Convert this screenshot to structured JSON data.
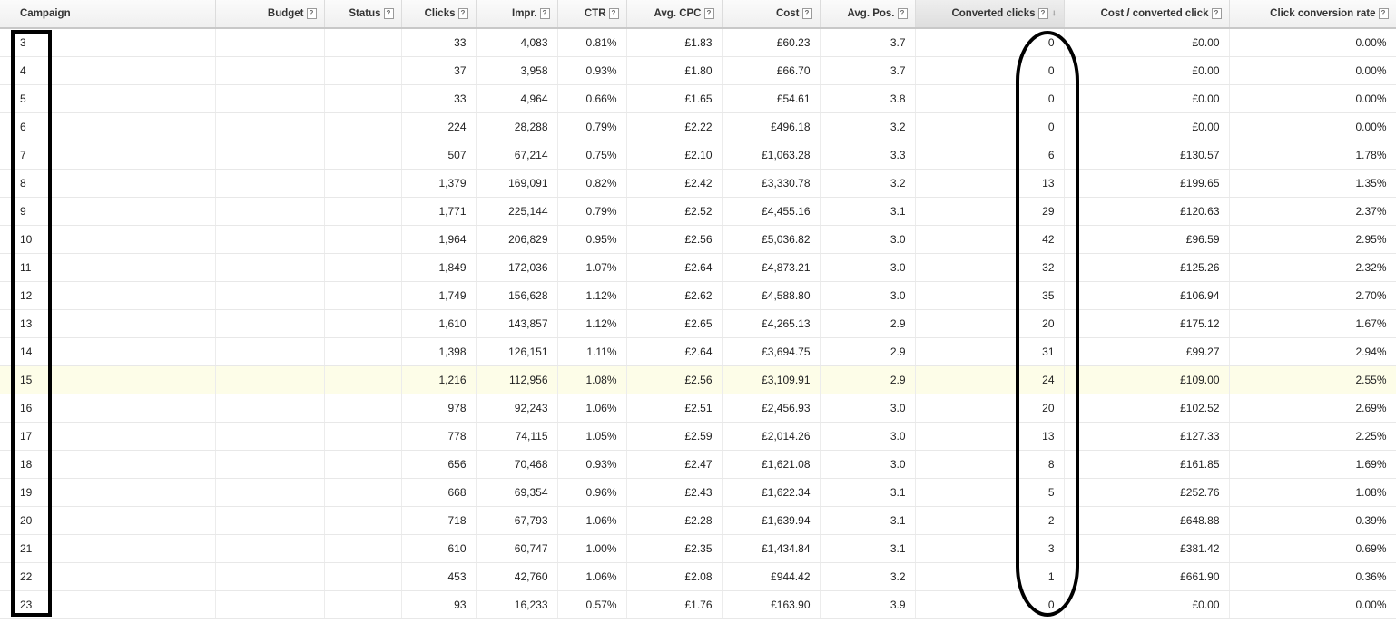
{
  "table": {
    "columns": [
      {
        "key": "campaign",
        "label": "Campaign",
        "help": false,
        "sorted": false
      },
      {
        "key": "budget",
        "label": "Budget",
        "help": true,
        "sorted": false
      },
      {
        "key": "status",
        "label": "Status",
        "help": true,
        "sorted": false
      },
      {
        "key": "clicks",
        "label": "Clicks",
        "help": true,
        "sorted": false
      },
      {
        "key": "impr",
        "label": "Impr.",
        "help": true,
        "sorted": false
      },
      {
        "key": "ctr",
        "label": "CTR",
        "help": true,
        "sorted": false
      },
      {
        "key": "avg_cpc",
        "label": "Avg. CPC",
        "help": true,
        "sorted": false
      },
      {
        "key": "cost",
        "label": "Cost",
        "help": true,
        "sorted": false
      },
      {
        "key": "avg_pos",
        "label": "Avg. Pos.",
        "help": true,
        "sorted": false
      },
      {
        "key": "converted_clicks",
        "label": "Converted clicks",
        "help": true,
        "sorted": true
      },
      {
        "key": "cost_per_converted",
        "label": "Cost / converted click",
        "help": true,
        "sorted": false
      },
      {
        "key": "click_conv_rate",
        "label": "Click conversion rate",
        "help": true,
        "sorted": false
      }
    ],
    "help_glyph": "?",
    "sort_glyph": "↓",
    "highlight_color": "#fdfde8",
    "annotation_color": "#000000",
    "rows": [
      {
        "campaign": "3",
        "budget": "",
        "status": "",
        "clicks": "33",
        "impr": "4,083",
        "ctr": "0.81%",
        "avg_cpc": "£1.83",
        "cost": "£60.23",
        "avg_pos": "3.7",
        "converted_clicks": "0",
        "cost_per_converted": "£0.00",
        "click_conv_rate": "0.00%"
      },
      {
        "campaign": "4",
        "budget": "",
        "status": "",
        "clicks": "37",
        "impr": "3,958",
        "ctr": "0.93%",
        "avg_cpc": "£1.80",
        "cost": "£66.70",
        "avg_pos": "3.7",
        "converted_clicks": "0",
        "cost_per_converted": "£0.00",
        "click_conv_rate": "0.00%"
      },
      {
        "campaign": "5",
        "budget": "",
        "status": "",
        "clicks": "33",
        "impr": "4,964",
        "ctr": "0.66%",
        "avg_cpc": "£1.65",
        "cost": "£54.61",
        "avg_pos": "3.8",
        "converted_clicks": "0",
        "cost_per_converted": "£0.00",
        "click_conv_rate": "0.00%"
      },
      {
        "campaign": "6",
        "budget": "",
        "status": "",
        "clicks": "224",
        "impr": "28,288",
        "ctr": "0.79%",
        "avg_cpc": "£2.22",
        "cost": "£496.18",
        "avg_pos": "3.2",
        "converted_clicks": "0",
        "cost_per_converted": "£0.00",
        "click_conv_rate": "0.00%"
      },
      {
        "campaign": "7",
        "budget": "",
        "status": "",
        "clicks": "507",
        "impr": "67,214",
        "ctr": "0.75%",
        "avg_cpc": "£2.10",
        "cost": "£1,063.28",
        "avg_pos": "3.3",
        "converted_clicks": "6",
        "cost_per_converted": "£130.57",
        "click_conv_rate": "1.78%"
      },
      {
        "campaign": "8",
        "budget": "",
        "status": "",
        "clicks": "1,379",
        "impr": "169,091",
        "ctr": "0.82%",
        "avg_cpc": "£2.42",
        "cost": "£3,330.78",
        "avg_pos": "3.2",
        "converted_clicks": "13",
        "cost_per_converted": "£199.65",
        "click_conv_rate": "1.35%"
      },
      {
        "campaign": "9",
        "budget": "",
        "status": "",
        "clicks": "1,771",
        "impr": "225,144",
        "ctr": "0.79%",
        "avg_cpc": "£2.52",
        "cost": "£4,455.16",
        "avg_pos": "3.1",
        "converted_clicks": "29",
        "cost_per_converted": "£120.63",
        "click_conv_rate": "2.37%"
      },
      {
        "campaign": "10",
        "budget": "",
        "status": "",
        "clicks": "1,964",
        "impr": "206,829",
        "ctr": "0.95%",
        "avg_cpc": "£2.56",
        "cost": "£5,036.82",
        "avg_pos": "3.0",
        "converted_clicks": "42",
        "cost_per_converted": "£96.59",
        "click_conv_rate": "2.95%"
      },
      {
        "campaign": "11",
        "budget": "",
        "status": "",
        "clicks": "1,849",
        "impr": "172,036",
        "ctr": "1.07%",
        "avg_cpc": "£2.64",
        "cost": "£4,873.21",
        "avg_pos": "3.0",
        "converted_clicks": "32",
        "cost_per_converted": "£125.26",
        "click_conv_rate": "2.32%"
      },
      {
        "campaign": "12",
        "budget": "",
        "status": "",
        "clicks": "1,749",
        "impr": "156,628",
        "ctr": "1.12%",
        "avg_cpc": "£2.62",
        "cost": "£4,588.80",
        "avg_pos": "3.0",
        "converted_clicks": "35",
        "cost_per_converted": "£106.94",
        "click_conv_rate": "2.70%"
      },
      {
        "campaign": "13",
        "budget": "",
        "status": "",
        "clicks": "1,610",
        "impr": "143,857",
        "ctr": "1.12%",
        "avg_cpc": "£2.65",
        "cost": "£4,265.13",
        "avg_pos": "2.9",
        "converted_clicks": "20",
        "cost_per_converted": "£175.12",
        "click_conv_rate": "1.67%"
      },
      {
        "campaign": "14",
        "budget": "",
        "status": "",
        "clicks": "1,398",
        "impr": "126,151",
        "ctr": "1.11%",
        "avg_cpc": "£2.64",
        "cost": "£3,694.75",
        "avg_pos": "2.9",
        "converted_clicks": "31",
        "cost_per_converted": "£99.27",
        "click_conv_rate": "2.94%"
      },
      {
        "campaign": "15",
        "budget": "",
        "status": "",
        "clicks": "1,216",
        "impr": "112,956",
        "ctr": "1.08%",
        "avg_cpc": "£2.56",
        "cost": "£3,109.91",
        "avg_pos": "2.9",
        "converted_clicks": "24",
        "cost_per_converted": "£109.00",
        "click_conv_rate": "2.55%",
        "highlighted": true
      },
      {
        "campaign": "16",
        "budget": "",
        "status": "",
        "clicks": "978",
        "impr": "92,243",
        "ctr": "1.06%",
        "avg_cpc": "£2.51",
        "cost": "£2,456.93",
        "avg_pos": "3.0",
        "converted_clicks": "20",
        "cost_per_converted": "£102.52",
        "click_conv_rate": "2.69%"
      },
      {
        "campaign": "17",
        "budget": "",
        "status": "",
        "clicks": "778",
        "impr": "74,115",
        "ctr": "1.05%",
        "avg_cpc": "£2.59",
        "cost": "£2,014.26",
        "avg_pos": "3.0",
        "converted_clicks": "13",
        "cost_per_converted": "£127.33",
        "click_conv_rate": "2.25%"
      },
      {
        "campaign": "18",
        "budget": "",
        "status": "",
        "clicks": "656",
        "impr": "70,468",
        "ctr": "0.93%",
        "avg_cpc": "£2.47",
        "cost": "£1,621.08",
        "avg_pos": "3.0",
        "converted_clicks": "8",
        "cost_per_converted": "£161.85",
        "click_conv_rate": "1.69%"
      },
      {
        "campaign": "19",
        "budget": "",
        "status": "",
        "clicks": "668",
        "impr": "69,354",
        "ctr": "0.96%",
        "avg_cpc": "£2.43",
        "cost": "£1,622.34",
        "avg_pos": "3.1",
        "converted_clicks": "5",
        "cost_per_converted": "£252.76",
        "click_conv_rate": "1.08%"
      },
      {
        "campaign": "20",
        "budget": "",
        "status": "",
        "clicks": "718",
        "impr": "67,793",
        "ctr": "1.06%",
        "avg_cpc": "£2.28",
        "cost": "£1,639.94",
        "avg_pos": "3.1",
        "converted_clicks": "2",
        "cost_per_converted": "£648.88",
        "click_conv_rate": "0.39%"
      },
      {
        "campaign": "21",
        "budget": "",
        "status": "",
        "clicks": "610",
        "impr": "60,747",
        "ctr": "1.00%",
        "avg_cpc": "£2.35",
        "cost": "£1,434.84",
        "avg_pos": "3.1",
        "converted_clicks": "3",
        "cost_per_converted": "£381.42",
        "click_conv_rate": "0.69%"
      },
      {
        "campaign": "22",
        "budget": "",
        "status": "",
        "clicks": "453",
        "impr": "42,760",
        "ctr": "1.06%",
        "avg_cpc": "£2.08",
        "cost": "£944.42",
        "avg_pos": "3.2",
        "converted_clicks": "1",
        "cost_per_converted": "£661.90",
        "click_conv_rate": "0.36%"
      },
      {
        "campaign": "23",
        "budget": "",
        "status": "",
        "clicks": "93",
        "impr": "16,233",
        "ctr": "0.57%",
        "avg_cpc": "£1.76",
        "cost": "£163.90",
        "avg_pos": "3.9",
        "converted_clicks": "0",
        "cost_per_converted": "£0.00",
        "click_conv_rate": "0.00%"
      }
    ]
  }
}
